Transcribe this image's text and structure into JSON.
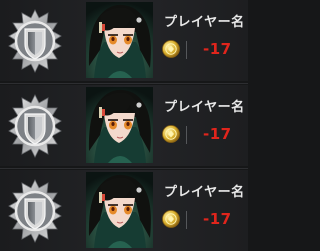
{
  "players": [
    {
      "name": "プレイヤー名",
      "score": "-17",
      "rank_icon": "silver-shield-emblem-icon",
      "currency_icon": "gold-coin-icon"
    },
    {
      "name": "プレイヤー名",
      "score": "-17",
      "rank_icon": "silver-shield-emblem-icon",
      "currency_icon": "gold-coin-icon"
    },
    {
      "name": "プレイヤー名",
      "score": "-17",
      "rank_icon": "silver-shield-emblem-icon",
      "currency_icon": "gold-coin-icon"
    }
  ],
  "colors": {
    "score": "#e0251c",
    "name": "#e8e8e8",
    "coin": "#d9b02e",
    "row_bg": "#232427"
  }
}
